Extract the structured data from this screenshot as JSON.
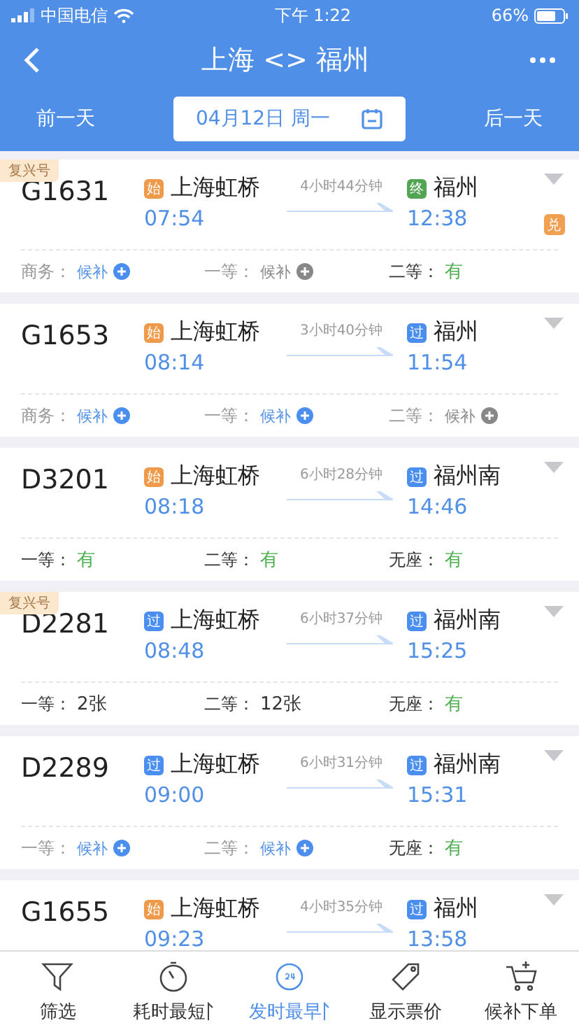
{
  "status_bar": {
    "carrier": "中国电信",
    "time": "下午 1:22",
    "battery": "66%"
  },
  "nav": {
    "title": "上海 <> 福州"
  },
  "date_bar": {
    "prev": "前一天",
    "date": "04月12日 周一",
    "next": "后一天"
  },
  "trains": [
    {
      "tag": "复兴号",
      "number": "G1631",
      "from": {
        "badge": "始",
        "kind": "start",
        "name": "上海虹桥",
        "time": "07:54"
      },
      "duration": "4小时44分钟",
      "to": {
        "badge": "终",
        "kind": "end",
        "name": "福州",
        "time": "12:38"
      },
      "extra_badge": "兑",
      "seats": [
        {
          "label": "商务：",
          "value": "候补",
          "kind": "waitlist"
        },
        {
          "label": "一等：",
          "value": "候补",
          "kind": "waitlist_off"
        },
        {
          "label": "二等：",
          "value": "有",
          "kind": "available"
        }
      ]
    },
    {
      "number": "G1653",
      "from": {
        "badge": "始",
        "kind": "start",
        "name": "上海虹桥",
        "time": "08:14"
      },
      "duration": "3小时40分钟",
      "to": {
        "badge": "过",
        "kind": "pass",
        "name": "福州",
        "time": "11:54"
      },
      "seats": [
        {
          "label": "商务：",
          "value": "候补",
          "kind": "waitlist"
        },
        {
          "label": "一等：",
          "value": "候补",
          "kind": "waitlist"
        },
        {
          "label": "二等：",
          "value": "候补",
          "kind": "waitlist_off"
        }
      ]
    },
    {
      "number": "D3201",
      "from": {
        "badge": "始",
        "kind": "start",
        "name": "上海虹桥",
        "time": "08:18"
      },
      "duration": "6小时28分钟",
      "to": {
        "badge": "过",
        "kind": "pass",
        "name": "福州南",
        "time": "14:46"
      },
      "seats": [
        {
          "label": "一等：",
          "value": "有",
          "kind": "available"
        },
        {
          "label": "二等：",
          "value": "有",
          "kind": "available"
        },
        {
          "label": "无座：",
          "value": "有",
          "kind": "available"
        }
      ]
    },
    {
      "tag": "复兴号",
      "number": "D2281",
      "from": {
        "badge": "过",
        "kind": "pass",
        "name": "上海虹桥",
        "time": "08:48"
      },
      "duration": "6小时37分钟",
      "to": {
        "badge": "过",
        "kind": "pass",
        "name": "福州南",
        "time": "15:25"
      },
      "seats": [
        {
          "label": "一等：",
          "value": "2张",
          "kind": "count"
        },
        {
          "label": "二等：",
          "value": "12张",
          "kind": "count"
        },
        {
          "label": "无座：",
          "value": "有",
          "kind": "available"
        }
      ]
    },
    {
      "number": "D2289",
      "from": {
        "badge": "过",
        "kind": "pass",
        "name": "上海虹桥",
        "time": "09:00"
      },
      "duration": "6小时31分钟",
      "to": {
        "badge": "过",
        "kind": "pass",
        "name": "福州南",
        "time": "15:31"
      },
      "seats": [
        {
          "label": "一等：",
          "value": "候补",
          "kind": "waitlist"
        },
        {
          "label": "二等：",
          "value": "候补",
          "kind": "waitlist"
        },
        {
          "label": "无座：",
          "value": "有",
          "kind": "available"
        }
      ]
    },
    {
      "number": "G1655",
      "from": {
        "badge": "始",
        "kind": "start",
        "name": "上海虹桥",
        "time": "09:23"
      },
      "duration": "4小时35分钟",
      "to": {
        "badge": "过",
        "kind": "pass",
        "name": "福州",
        "time": "13:58"
      }
    }
  ],
  "tab_bar": [
    {
      "label": "筛选",
      "selected": false,
      "sort": false
    },
    {
      "label": "耗时最短",
      "selected": false,
      "sort": true
    },
    {
      "label": "发时最早",
      "selected": true,
      "sort": true
    },
    {
      "label": "显示票价",
      "selected": false,
      "sort": false
    },
    {
      "label": "候补下单",
      "selected": false,
      "sort": false
    }
  ]
}
